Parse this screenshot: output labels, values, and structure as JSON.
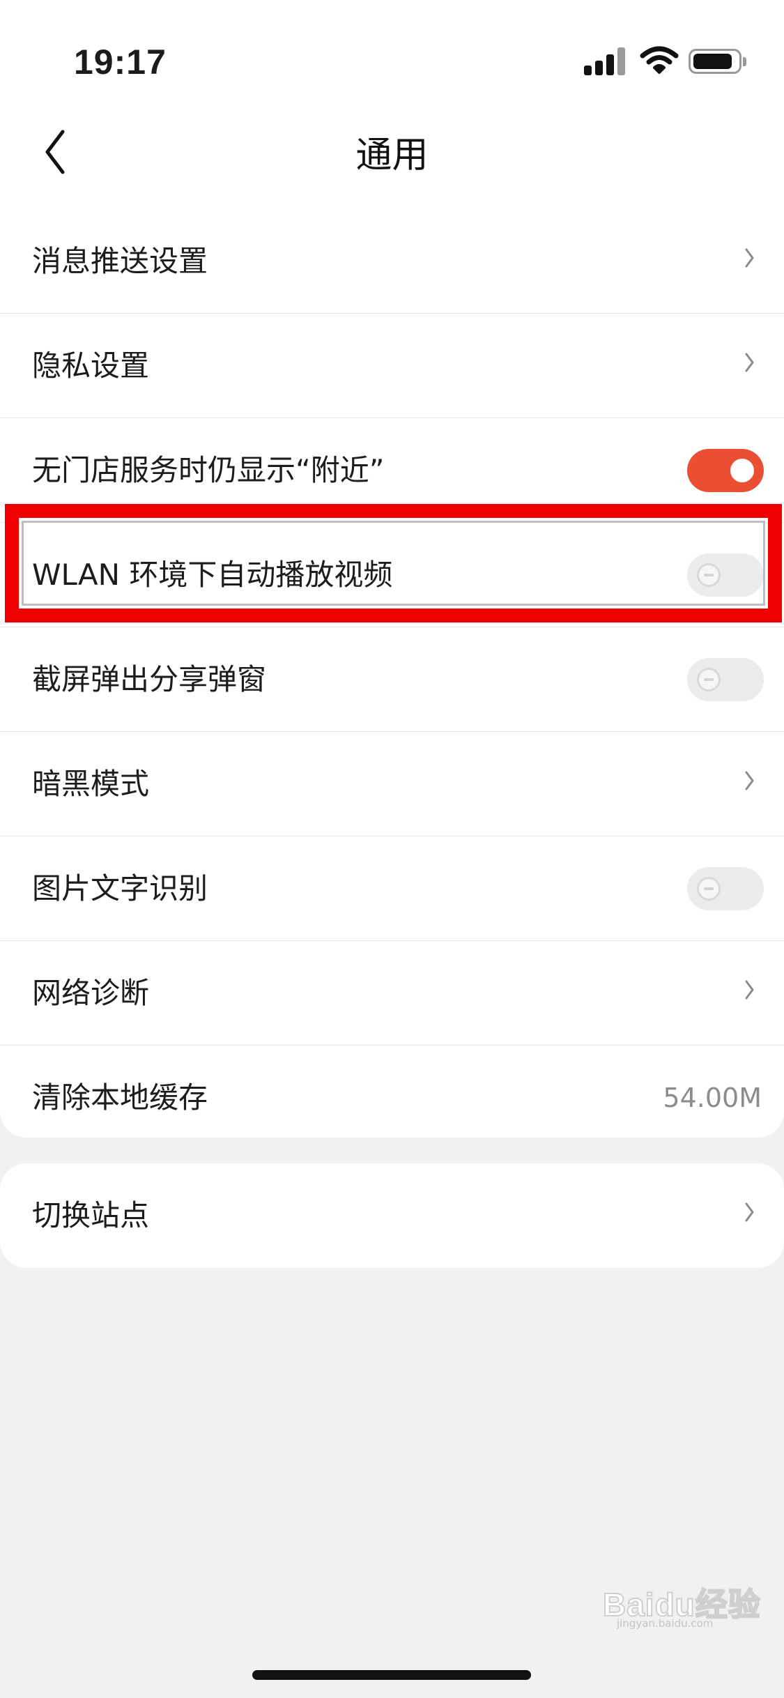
{
  "status_bar": {
    "time": "19:17"
  },
  "header": {
    "title": "通用"
  },
  "settings": [
    {
      "label": "消息推送设置",
      "control": "chevron"
    },
    {
      "label": "隐私设置",
      "control": "chevron"
    },
    {
      "label": "无门店服务时仍显示“附近”",
      "control": "toggle",
      "state": "on"
    },
    {
      "label": "WLAN 环境下自动播放视频",
      "control": "toggle",
      "state": "off",
      "highlighted": true
    },
    {
      "label": "截屏弹出分享弹窗",
      "control": "toggle",
      "state": "off"
    },
    {
      "label": "暗黑模式",
      "control": "chevron"
    },
    {
      "label": "图片文字识别",
      "control": "toggle",
      "state": "off"
    },
    {
      "label": "网络诊断",
      "control": "chevron"
    },
    {
      "label": "清除本地缓存",
      "control": "value",
      "value": "54.00M"
    }
  ],
  "secondary": [
    {
      "label": "切换站点",
      "control": "chevron"
    }
  ],
  "watermark": {
    "text": "Baidu经验",
    "sub": "jingyan.baidu.com"
  },
  "colors": {
    "toggle_on": "#ea4e33",
    "highlight_box": "#ee0000",
    "background": "#f1f1f1"
  },
  "icons": [
    "signal-icon",
    "wifi-icon",
    "battery-icon",
    "back-arrow-icon",
    "chevron-right-icon"
  ]
}
